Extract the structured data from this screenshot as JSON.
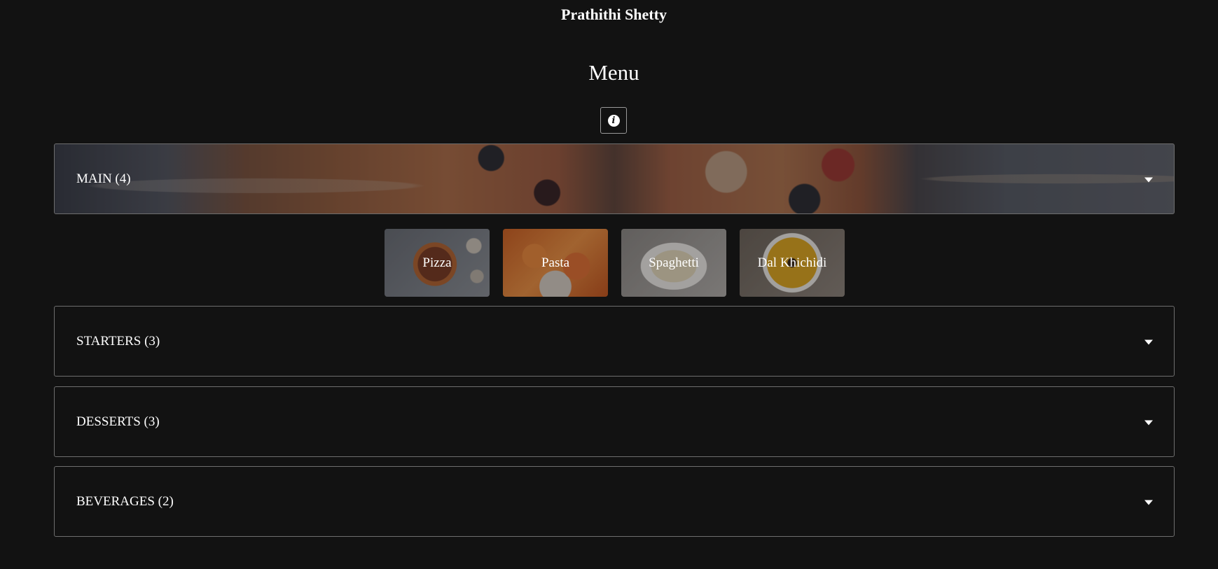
{
  "header": {
    "owner_name": "Prathithi Shetty",
    "page_title": "Menu"
  },
  "info_button": {
    "icon": "info-icon",
    "glyph": "i"
  },
  "categories": [
    {
      "label": "MAIN (4)",
      "expanded": true
    },
    {
      "label": "STARTERS (3)",
      "expanded": false
    },
    {
      "label": "DESSERTS (3)",
      "expanded": false
    },
    {
      "label": "BEVERAGES (2)",
      "expanded": false
    }
  ],
  "main_items": [
    {
      "name": "Pizza"
    },
    {
      "name": "Pasta"
    },
    {
      "name": "Spaghetti"
    },
    {
      "name": "Dal Khichidi"
    }
  ],
  "colors": {
    "background": "#121212",
    "text": "#ffffff",
    "border": "#6e6e6e"
  }
}
